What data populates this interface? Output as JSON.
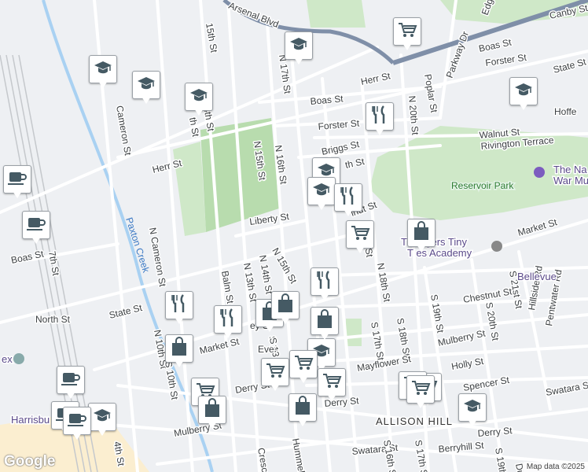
{
  "map": {
    "street_labels": [
      "15th St",
      "Arsenal Blvd",
      "N 17th St",
      "Canby St",
      "Edge",
      "Boas St",
      "Poplar St",
      "Parkway Dr",
      "Forster St",
      "State St",
      "Herr St",
      "N 20th St",
      "Hoffe",
      "Cameron St",
      "14th St",
      "th St",
      "Boas St",
      "Forster St",
      "N 15th St",
      "N 16th St",
      "Walnut St",
      "Rivington Terrace",
      "Herr St",
      "Briggs St",
      "th St",
      "Liberty St",
      "lnut St",
      "N Cameron St",
      "Market St",
      "N 18th St",
      "17th St",
      "S 21st St",
      "Boas St",
      "7th St",
      "N 15th St",
      "N 14th St",
      "N 13th St",
      "Balm St",
      "Chestnut St",
      "S 19th St",
      "S 20th St",
      "Hillside Rd",
      "Pentwater Rd",
      "North St",
      "State St",
      "S 17th St",
      "S 18th St",
      "Mulberry St",
      "Market St",
      "N 10th St",
      "S 10th St",
      "Mayflower St",
      "Holly St",
      "Spencer St",
      "Swatara St",
      "Derry St",
      "Derry St",
      "Derry St",
      "Mulberry St",
      "4th St",
      "Swatara St",
      "Berryhill St",
      "S 16th St",
      "S 17th St",
      "S 19th",
      "Hummel",
      "Crescen",
      "S 15",
      "S 13",
      "Eve",
      "ey S",
      "Du"
    ],
    "park_labels": [
      "Reservoir Park"
    ],
    "poi_labels": [
      "The Na",
      "War Mu",
      "T",
      "ngers Tiny",
      "T  es Academy",
      "Bellevue",
      "Harrisbu",
      "ex"
    ],
    "area_labels": [
      "ALLISON HILL"
    ],
    "waterway_labels": [
      "Paxton Creek"
    ],
    "markers": [
      {
        "icon": "graduation-cap-icon"
      },
      {
        "icon": "graduation-cap-icon"
      },
      {
        "icon": "graduation-cap-icon"
      },
      {
        "icon": "graduation-cap-icon"
      },
      {
        "icon": "graduation-cap-icon"
      },
      {
        "icon": "graduation-cap-icon"
      },
      {
        "icon": "graduation-cap-icon"
      },
      {
        "icon": "graduation-cap-icon"
      },
      {
        "icon": "graduation-cap-icon"
      },
      {
        "icon": "graduation-cap-icon"
      },
      {
        "icon": "cart-icon"
      },
      {
        "icon": "cart-icon"
      },
      {
        "icon": "cart-icon"
      },
      {
        "icon": "cart-icon"
      },
      {
        "icon": "cart-icon"
      },
      {
        "icon": "cart-icon"
      },
      {
        "icon": "cart-icon"
      },
      {
        "icon": "cart-icon"
      },
      {
        "icon": "cart-icon"
      },
      {
        "icon": "restaurant-icon"
      },
      {
        "icon": "restaurant-icon"
      },
      {
        "icon": "restaurant-icon"
      },
      {
        "icon": "restaurant-icon"
      },
      {
        "icon": "restaurant-icon"
      },
      {
        "icon": "shopping-bag-icon"
      },
      {
        "icon": "shopping-bag-icon"
      },
      {
        "icon": "shopping-bag-icon"
      },
      {
        "icon": "shopping-bag-icon"
      },
      {
        "icon": "shopping-bag-icon"
      },
      {
        "icon": "shopping-bag-icon"
      },
      {
        "icon": "shopping-bag-icon"
      },
      {
        "icon": "cafe-icon"
      },
      {
        "icon": "cafe-icon"
      },
      {
        "icon": "cafe-icon"
      },
      {
        "icon": "cafe-icon"
      },
      {
        "icon": "cafe-icon"
      }
    ],
    "colors": {
      "park": "#cfe8c8",
      "water": "#a9d1f2",
      "highway": "#7f8fa8",
      "cemetery": "#b8dcae",
      "downtown": "#fbeed0"
    }
  },
  "footer": {
    "logo": "Google",
    "attribution": "Map data ©2025"
  }
}
